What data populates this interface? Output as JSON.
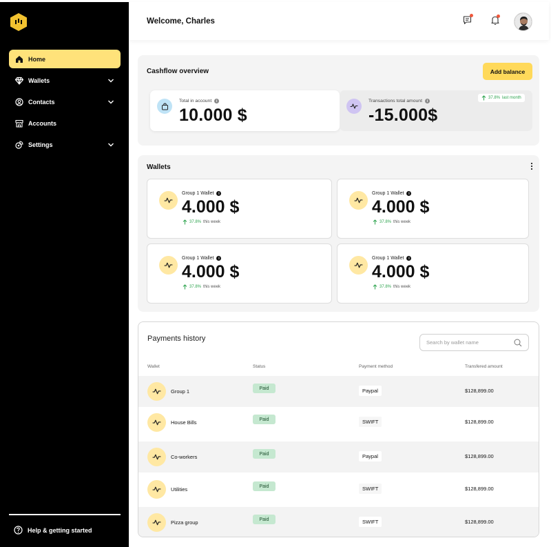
{
  "sidebar": {
    "items": [
      {
        "label": "Home",
        "icon": "home-icon",
        "active": true,
        "chevron": false
      },
      {
        "label": "Wallets",
        "icon": "diamond-icon",
        "active": false,
        "chevron": true
      },
      {
        "label": "Contacts",
        "icon": "contacts-icon",
        "active": false,
        "chevron": true
      },
      {
        "label": "Accounts",
        "icon": "store-icon",
        "active": false,
        "chevron": false
      },
      {
        "label": "Settings",
        "icon": "settings-icon",
        "active": false,
        "chevron": true
      }
    ],
    "help_label": "Help & getting started"
  },
  "header": {
    "welcome": "Welcome, Charles",
    "icons": [
      "message-icon",
      "bell-icon"
    ]
  },
  "cashflow": {
    "title": "Cashflow overview",
    "add_balance_label": "Add balance",
    "total_label": "Total in account",
    "total_value": "10.000 $",
    "transactions_label": "Transactions total amount",
    "transactions_value": "-15.000$",
    "trend_value": "37.8%",
    "trend_suffix": "last month"
  },
  "wallets": {
    "title": "Wallets",
    "cards": [
      {
        "label": "Group 1 Wallet",
        "value": "4.000 $",
        "trend": "37.8%",
        "trend_suffix": "this week"
      },
      {
        "label": "Group 1 Wallet",
        "value": "4.000 $",
        "trend": "37.8%",
        "trend_suffix": "this week"
      },
      {
        "label": "Group 1 Wallet",
        "value": "4.000 $",
        "trend": "37.8%",
        "trend_suffix": "this week"
      },
      {
        "label": "Group 1 Wallet",
        "value": "4.000 $",
        "trend": "37.8%",
        "trend_suffix": "this week"
      }
    ]
  },
  "payments": {
    "title": "Payments history",
    "search_placeholder": "Search by wallet name",
    "columns": [
      "Wallet",
      "Status",
      "Payment method",
      "Transfered amount"
    ],
    "rows": [
      {
        "wallet": "Group 1",
        "status": "Paid",
        "method": "Paypal",
        "amount": "$128,899.00"
      },
      {
        "wallet": "House Bills",
        "status": "Paid",
        "method": "SWIFT",
        "amount": "$128,899.00"
      },
      {
        "wallet": "Co-workers",
        "status": "Paid",
        "method": "Paypal",
        "amount": "$128,899.00"
      },
      {
        "wallet": "Utilities",
        "status": "Paid",
        "method": "SWIFT",
        "amount": "$128,899.00"
      },
      {
        "wallet": "Pizza group",
        "status": "Paid",
        "method": "SWIFT",
        "amount": "$128,899.00"
      }
    ]
  },
  "colors": {
    "accent": "#ffd95a",
    "active_nav": "#ffe27a",
    "wallet_icon_bg": "#ffe8a3",
    "trend_green": "#2ea44f",
    "status_bg": "#c5e8d0",
    "sidebar_bg": "#000000"
  }
}
